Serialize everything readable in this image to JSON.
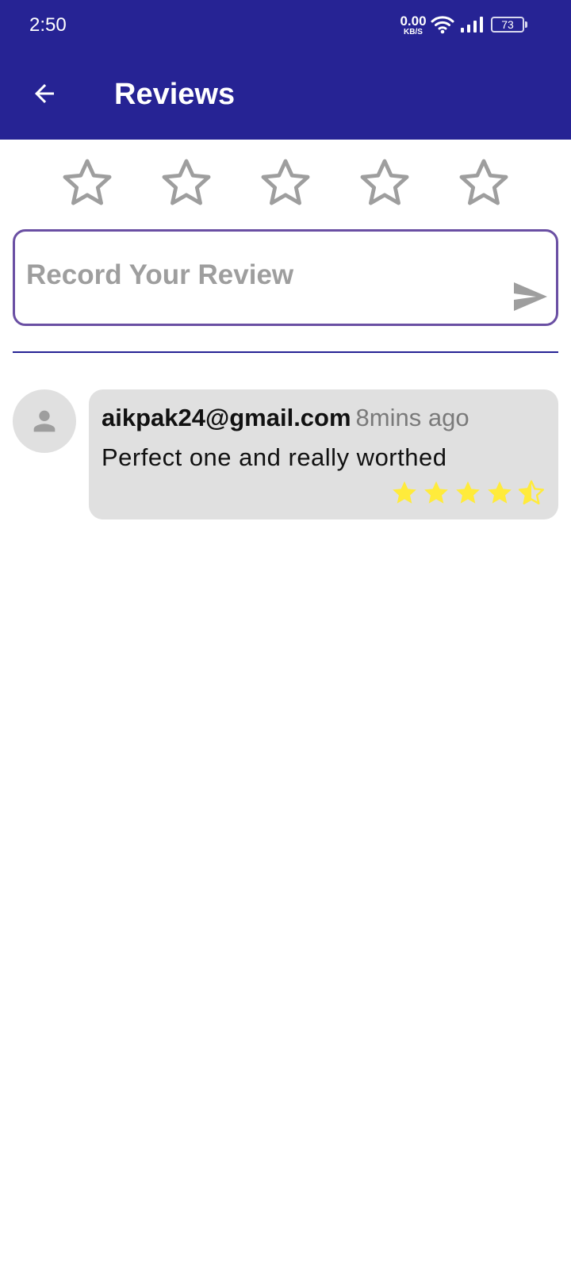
{
  "status_bar": {
    "time": "2:50",
    "net_speed_value": "0.00",
    "net_speed_unit": "KB/S",
    "battery": "73",
    "icons": [
      "wifi-icon",
      "signal-icon",
      "battery-icon"
    ]
  },
  "app_bar": {
    "title": "Reviews",
    "back_icon": "arrow-left-icon",
    "color": "#262394"
  },
  "rating_input": {
    "max_stars": 5,
    "selected": 0,
    "star_color": "#9e9e9e"
  },
  "review_input": {
    "placeholder": "Record Your Review",
    "value": "",
    "send_icon": "send-icon",
    "border_color": "#6a4fa3"
  },
  "reviews": [
    {
      "email": "aikpak24@gmail.com",
      "time_ago": "8mins ago",
      "text": "Perfect one and really worthed",
      "rating": 4.5,
      "max_rating": 5,
      "star_color": "#ffeb3b",
      "avatar_icon": "person-icon"
    }
  ]
}
